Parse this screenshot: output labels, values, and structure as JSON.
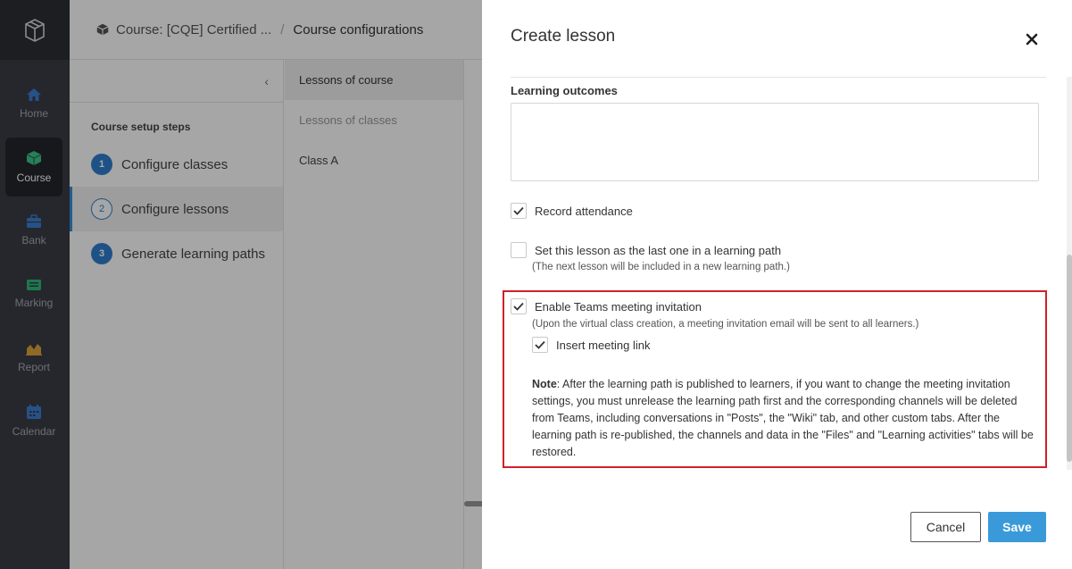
{
  "rail": {
    "items": [
      {
        "label": "Home",
        "icon": "home-icon",
        "color": "#3b7fd0"
      },
      {
        "label": "Course",
        "icon": "cube-icon",
        "color": "#3ec48a"
      },
      {
        "label": "Bank",
        "icon": "briefcase-icon",
        "color": "#3b7fd0"
      },
      {
        "label": "Marking",
        "icon": "card-icon",
        "color": "#2fb87a"
      },
      {
        "label": "Report",
        "icon": "area-chart-icon",
        "color": "#d9a43a"
      },
      {
        "label": "Calendar",
        "icon": "calendar-icon",
        "color": "#3b7fd0"
      }
    ],
    "active": "Course"
  },
  "breadcrumb": {
    "course": "Course: [CQE] Certified ...",
    "current": "Course configurations"
  },
  "setup": {
    "collapse_glyph": "‹",
    "title": "Course setup steps",
    "steps": [
      {
        "num": "1",
        "label": "Configure classes"
      },
      {
        "num": "2",
        "label": "Configure lessons"
      },
      {
        "num": "3",
        "label": "Generate learning paths"
      }
    ]
  },
  "lessons": {
    "header": "Lessons of course",
    "sub": "Lessons of classes",
    "class": "Class A"
  },
  "dialog": {
    "title": "Create lesson",
    "learning_outcomes_label": "Learning outcomes",
    "record_attendance": "Record attendance",
    "last_lesson": "Set this lesson as the last one in a learning path",
    "last_lesson_hint": "(The next lesson will be included in a new learning path.)",
    "teams_invitation": "Enable Teams meeting invitation",
    "teams_hint": "(Upon the virtual class creation, a meeting invitation email will be sent to all learners.)",
    "insert_link": "Insert meeting link",
    "note_label": "Note",
    "note_text": ": After the learning path is published to learners, if you want to change the meeting invitation settings, you must unrelease the learning path first and the corresponding channels will be deleted from Teams, including conversations in \"Posts\", the \"Wiki\" tab, and other custom tabs. After the learning path is re-published, the channels and data in the \"Files\" and \"Learning activities\" tabs will be restored.",
    "cancel": "Cancel",
    "save": "Save"
  },
  "colors": {
    "accent": "#3a9ad9",
    "highlight": "#d0202a"
  }
}
